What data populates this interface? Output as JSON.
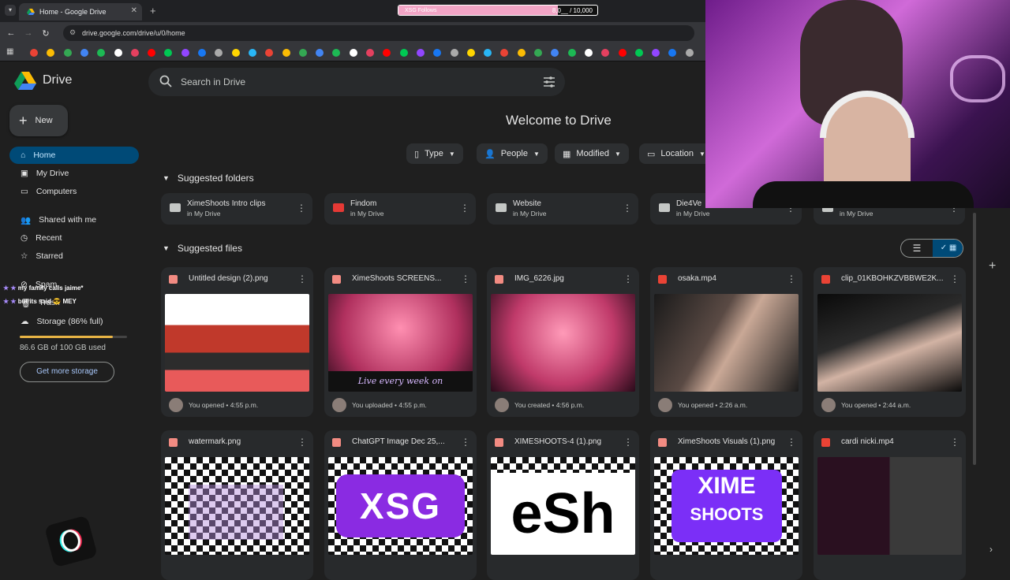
{
  "browser": {
    "tab_title": "Home - Google Drive",
    "url": "drive.google.com/drive/u/0/home"
  },
  "overlay": {
    "follow_label": "XSG Follows",
    "follow_count": "8,0__ / 10,000",
    "follow_progress": 0.8,
    "chat": [
      "my family calls jaime*",
      "but its said",
      "MEY"
    ]
  },
  "drive": {
    "app_name": "Drive",
    "search_placeholder": "Search in Drive",
    "new_label": "New",
    "nav": [
      "Home",
      "My Drive",
      "Computers",
      "Shared with me",
      "Recent",
      "Starred",
      "Spam",
      "Trash",
      "Storage (86% full)"
    ],
    "storage_used": "86.6 GB of 100 GB used",
    "storage_fraction": 0.866,
    "get_more": "Get more storage",
    "welcome": "Welcome to Drive",
    "filters": [
      "Type",
      "People",
      "Modified",
      "Location"
    ],
    "suggested_folders_title": "Suggested folders",
    "suggested_files_title": "Suggested files",
    "folders": [
      {
        "name": "XimeShoots Intro clips",
        "location": "in My Drive",
        "color": "#c4c7c5"
      },
      {
        "name": "Findom",
        "location": "in My Drive",
        "color": "#e53935"
      },
      {
        "name": "Website",
        "location": "in My Drive",
        "color": "#c4c7c5"
      },
      {
        "name": "Die4Ve",
        "location": "in My Drive",
        "color": "#c4c7c5"
      },
      {
        "name": "",
        "location": "in My Drive",
        "color": "#c4c7c5"
      }
    ],
    "files": [
      {
        "name": "Untitled design (2).png",
        "activity": "You opened • 4:55 p.m.",
        "type": "image"
      },
      {
        "name": "XimeShoots SCREENS...",
        "activity": "You uploaded • 4:55 p.m.",
        "type": "image"
      },
      {
        "name": "IMG_6226.jpg",
        "activity": "You created • 4:56 p.m.",
        "type": "image"
      },
      {
        "name": "osaka.mp4",
        "activity": "You opened • 2:26 a.m.",
        "type": "video"
      },
      {
        "name": "clip_01KBOHKZVBBWE2K...",
        "activity": "You opened • 2:44 a.m.",
        "type": "video"
      },
      {
        "name": "watermark.png",
        "activity": "",
        "type": "image"
      },
      {
        "name": "ChatGPT Image Dec 25,...",
        "activity": "",
        "type": "image"
      },
      {
        "name": "XIMESHOOTS-4 (1).png",
        "activity": "",
        "type": "image"
      },
      {
        "name": "XimeShoots Visuals (1).png",
        "activity": "",
        "type": "image"
      },
      {
        "name": "cardi nicki.mp4",
        "activity": "",
        "type": "video"
      }
    ],
    "thumb_text": {
      "xime_banner": "Live every week on",
      "chatgpt": "XSG",
      "ximeshoots4": "eSh",
      "visuals_top": "XIME",
      "visuals_bottom": "SHOOTS"
    }
  }
}
